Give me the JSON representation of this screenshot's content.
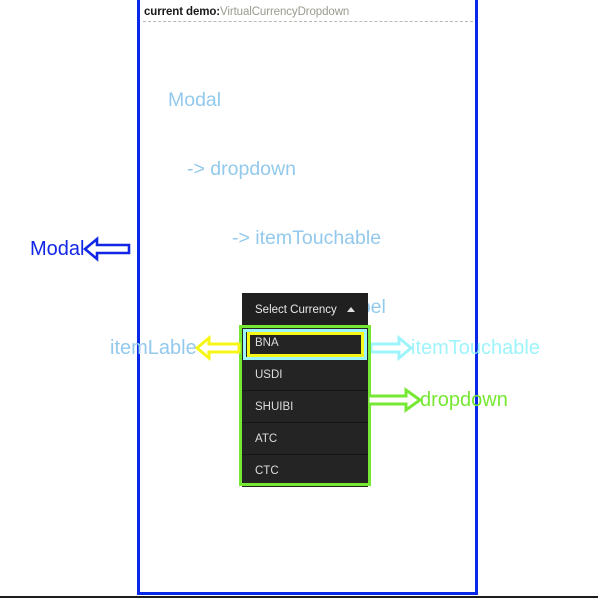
{
  "header": {
    "label": "current demo:",
    "value": "VirtualCurrencyDropdown"
  },
  "hierarchy": {
    "line1": "Modal",
    "line2": "-> dropdown",
    "line3": "-> itemTouchable",
    "line4": "-> itemLabel"
  },
  "dropdown": {
    "title": "Select Currency",
    "caret": "caret-up-icon",
    "items": [
      {
        "label": "BNA"
      },
      {
        "label": "USDI"
      },
      {
        "label": "SHUIBI"
      },
      {
        "label": "ATC"
      },
      {
        "label": "CTC"
      }
    ]
  },
  "annotations": {
    "modal": {
      "text": "Modal",
      "color": "#1226e6",
      "arrow": "arrow-left-icon"
    },
    "item_label": {
      "text": "itemLable",
      "color": "#93c9ec",
      "arrow": "arrow-left-icon"
    },
    "item_touchable": {
      "text": "itemTouchable",
      "color": "#9df4fb",
      "arrow": "arrow-right-icon"
    },
    "dropdown": {
      "text": "dropdown",
      "color": "#76e833",
      "arrow": "arrow-right-icon"
    }
  },
  "colors": {
    "modal_border": "#0a28e8",
    "dropdown_box": "#76e833",
    "item_touchable_box": "#9df4fb",
    "item_label_box": "#f7f717",
    "hierarchy_text": "#93c9ec",
    "widget_bg": "#242424"
  }
}
